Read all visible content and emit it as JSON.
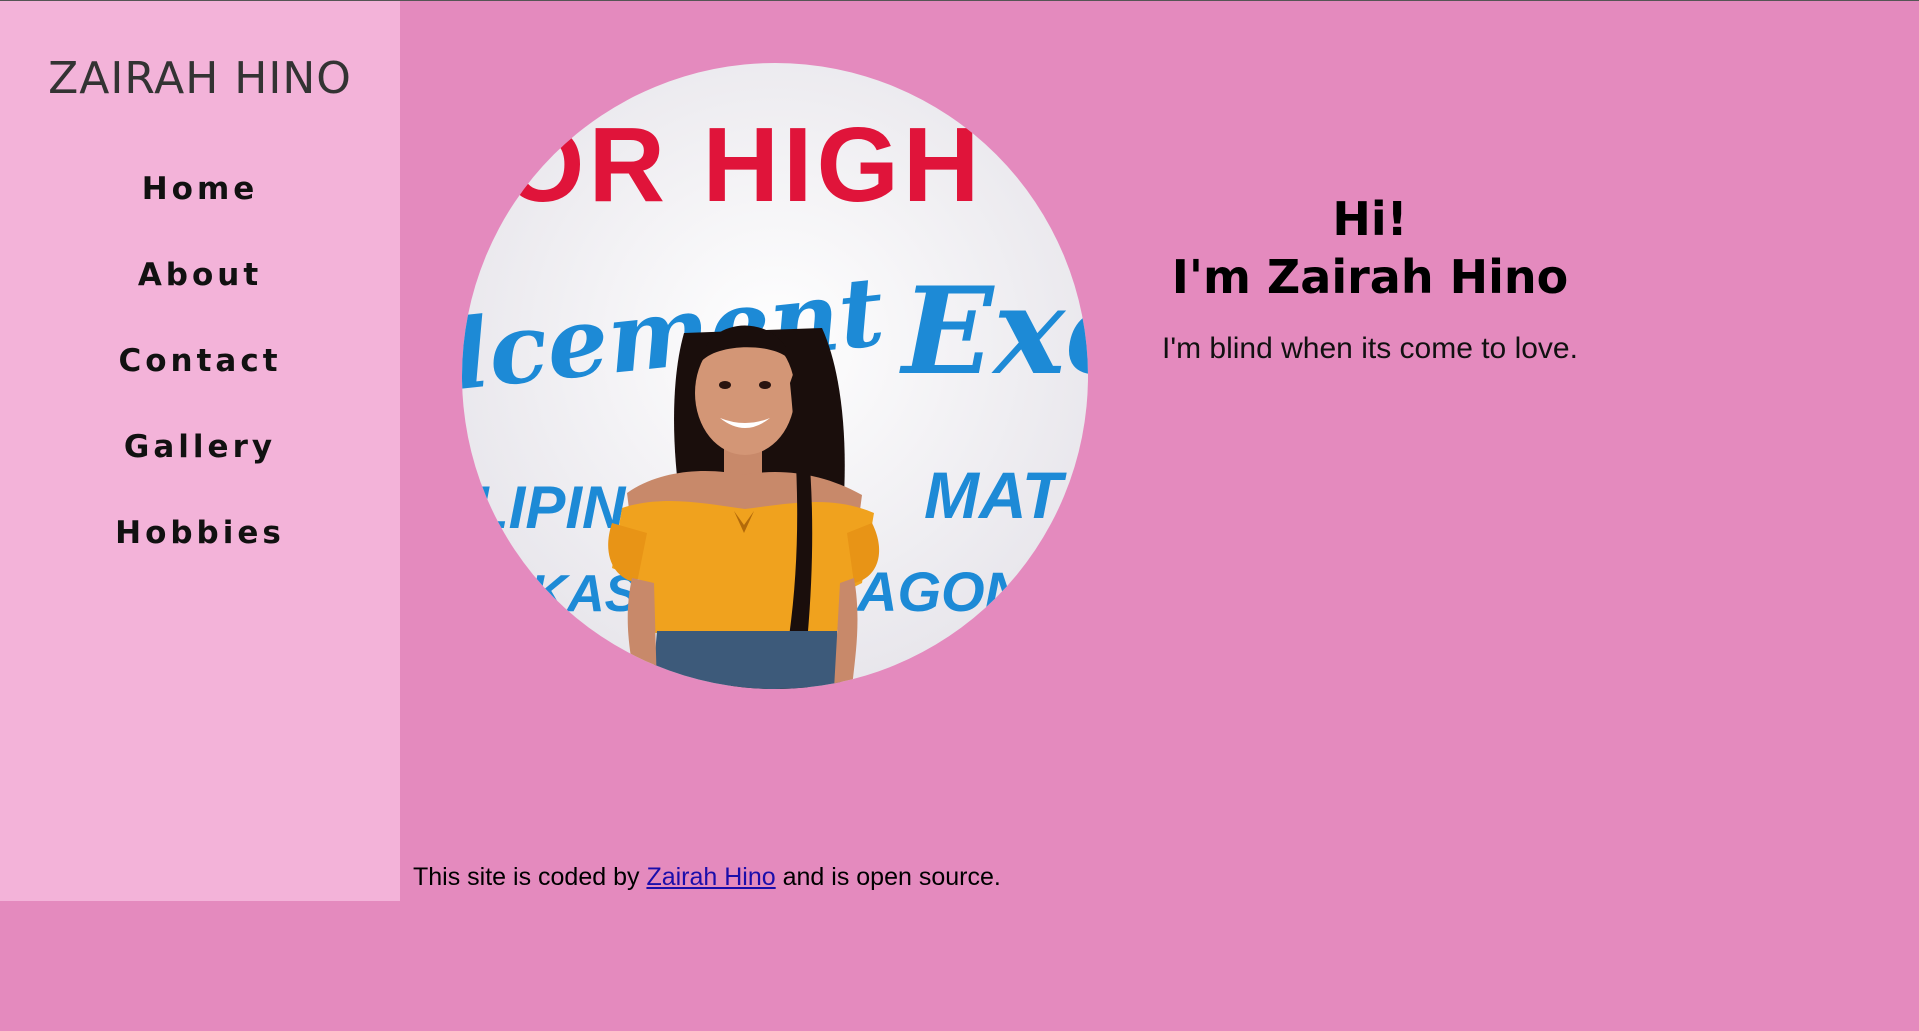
{
  "colors": {
    "page_background": "#e48abe",
    "sidebar_background": "#f3b3d9",
    "link": "#1a0dab"
  },
  "sidebar": {
    "brand": "ZAIRAH HINO",
    "nav": [
      {
        "label": "Home"
      },
      {
        "label": "About"
      },
      {
        "label": "Contact"
      },
      {
        "label": "Gallery"
      },
      {
        "label": "Hobbies"
      }
    ]
  },
  "profile_photo": {
    "sign_top": "OR HIGH",
    "sign_middle_left": "lcement",
    "sign_middle_right": "Exe",
    "sign_lower_left": "LIPINO",
    "sign_lower_right": "MATA",
    "sign_bottom_left": "UKAS",
    "sign_bottom_right": "AGONO"
  },
  "intro": {
    "greeting_line1": "Hi!",
    "greeting_line2": "I'm Zairah Hino",
    "tagline": "I'm blind when its come to love."
  },
  "footer": {
    "prefix": "This site is coded by ",
    "link_text": "Zairah Hino",
    "suffix": " and is open source."
  }
}
